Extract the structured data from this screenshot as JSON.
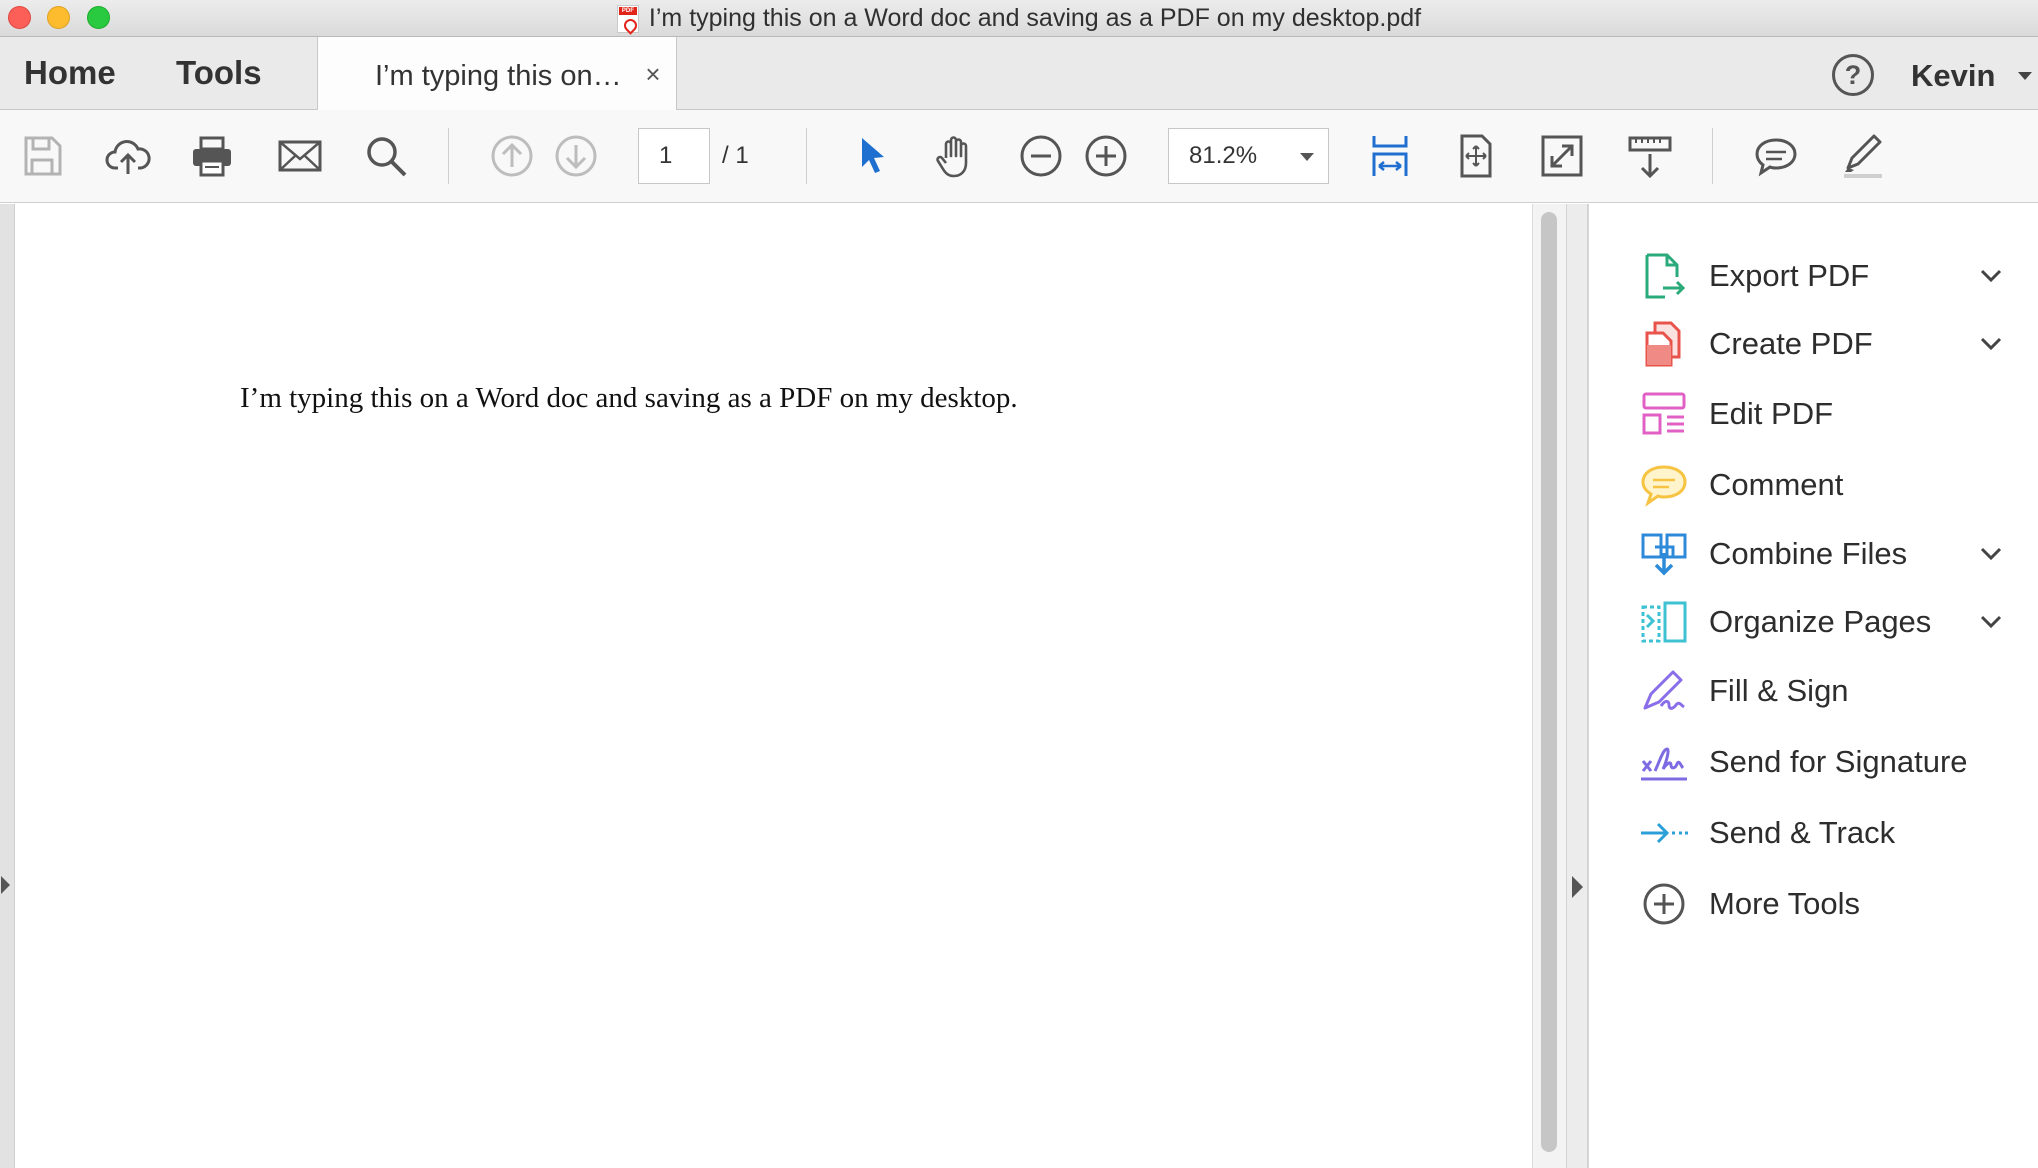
{
  "window": {
    "title": "I’m typing this on a Word doc and saving as a PDF on my desktop.pdf"
  },
  "tabs": {
    "home_label": "Home",
    "tools_label": "Tools",
    "document_tab_label": "I’m typing this on…",
    "close_glyph": "×"
  },
  "header": {
    "help_glyph": "?",
    "user_name": "Kevin"
  },
  "toolbar": {
    "icons": [
      "save-icon",
      "upload-cloud-icon",
      "print-icon",
      "email-icon",
      "search-icon",
      "previous-page-icon",
      "next-page-icon",
      "select-cursor-icon",
      "hand-icon",
      "zoom-out-icon",
      "zoom-in-icon",
      "fit-width-icon",
      "fit-page-icon",
      "full-screen-icon",
      "scroll-mode-icon",
      "comment-icon",
      "highlight-icon"
    ],
    "current_page": "1",
    "page_total": "/  1",
    "zoom_value": "81.2%"
  },
  "document": {
    "body_text": "I’m typing this on a Word doc and saving as a PDF on my desktop."
  },
  "tools_pane": {
    "items": [
      {
        "label": "Export PDF",
        "icon": "export-pdf-icon",
        "color": "#2bab7b",
        "expandable": true
      },
      {
        "label": "Create PDF",
        "icon": "create-pdf-icon",
        "color": "#e8534b",
        "expandable": true
      },
      {
        "label": "Edit PDF",
        "icon": "edit-pdf-icon",
        "color": "#e060c6",
        "expandable": false
      },
      {
        "label": "Comment",
        "icon": "comment-icon",
        "color": "#f6c342",
        "expandable": false
      },
      {
        "label": "Combine Files",
        "icon": "combine-files-icon",
        "color": "#2d8ad8",
        "expandable": true
      },
      {
        "label": "Organize Pages",
        "icon": "organize-pages-icon",
        "color": "#3ec1d3",
        "expandable": true
      },
      {
        "label": "Fill & Sign",
        "icon": "fill-sign-icon",
        "color": "#8a6de9",
        "expandable": false
      },
      {
        "label": "Send for Signature",
        "icon": "send-signature-icon",
        "color": "#7c6be3",
        "expandable": false
      },
      {
        "label": "Send & Track",
        "icon": "send-track-icon",
        "color": "#2b9fd8",
        "expandable": false
      },
      {
        "label": "More Tools",
        "icon": "more-tools-icon",
        "color": "#555555",
        "expandable": false
      }
    ]
  }
}
